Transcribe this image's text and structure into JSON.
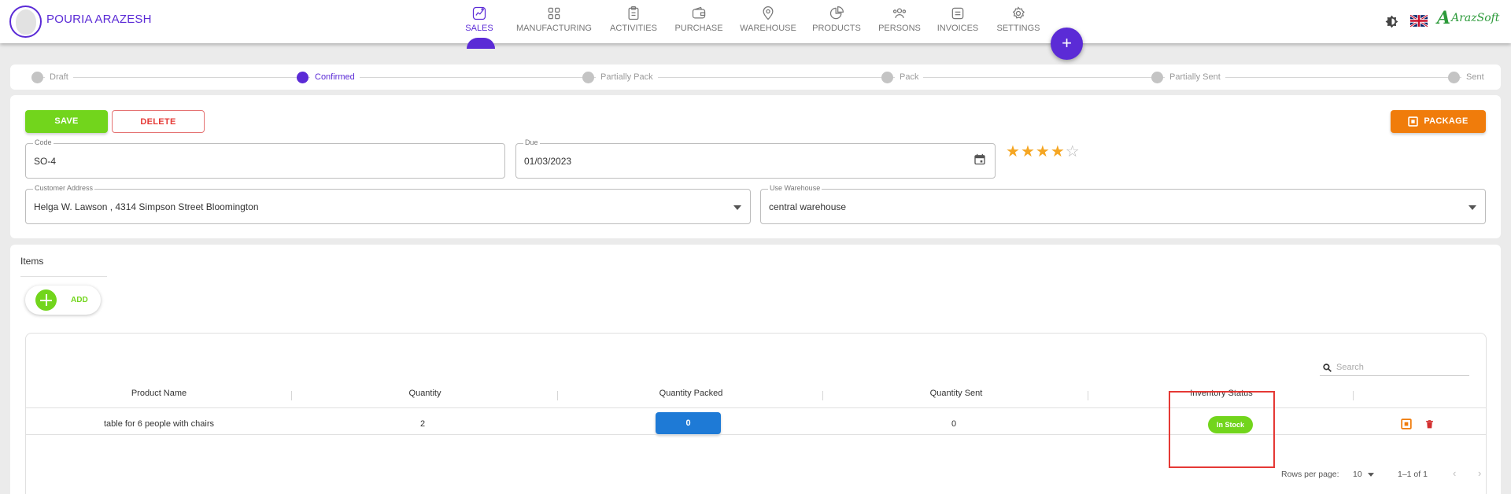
{
  "user": {
    "name": "POURIA ARAZESH"
  },
  "nav": [
    {
      "label": "SALES",
      "icon": "sales-chart-icon",
      "active": true
    },
    {
      "label": "MANUFACTURING",
      "icon": "manufacturing-grid-icon",
      "active": false
    },
    {
      "label": "ACTIVITIES",
      "icon": "activities-clipboard-icon",
      "active": false
    },
    {
      "label": "PURCHASE",
      "icon": "purchase-wallet-icon",
      "active": false
    },
    {
      "label": "WAREHOUSE",
      "icon": "warehouse-pin-icon",
      "active": false
    },
    {
      "label": "PRODUCTS",
      "icon": "products-pie-icon",
      "active": false
    },
    {
      "label": "PERSONS",
      "icon": "persons-icon",
      "active": false
    },
    {
      "label": "INVOICES",
      "icon": "invoices-icon",
      "active": false
    },
    {
      "label": "SETTINGS",
      "icon": "settings-gear-icon",
      "active": false
    }
  ],
  "fab": {
    "label": "+"
  },
  "brand": {
    "mark": "A",
    "text": "ArazSoft"
  },
  "stepper": {
    "steps": [
      "Draft",
      "Confirmed",
      "Partially Pack",
      "Pack",
      "Partially Sent",
      "Sent"
    ],
    "active_index": 1
  },
  "form": {
    "save_label": "SAVE",
    "delete_label": "DELETE",
    "package_label": "PACKAGE",
    "code": {
      "label": "Code",
      "value": "SO-4"
    },
    "due": {
      "label": "Due",
      "value": "01/03/2023"
    },
    "rating": {
      "value": 4,
      "max": 5
    },
    "customer_address": {
      "label": "Customer Address",
      "value": "Helga W. Lawson , 4314 Simpson Street Bloomington"
    },
    "warehouse": {
      "label": "Use Warehouse",
      "value": "central warehouse"
    }
  },
  "items": {
    "title": "Items",
    "add_label": "ADD",
    "search_placeholder": "Search",
    "columns": [
      "Product Name",
      "Quantity",
      "Quantity Packed",
      "Quantity Sent",
      "Inventory Status"
    ],
    "rows": [
      {
        "product": "table for 6 people with chairs",
        "quantity": "2",
        "quantity_packed": "0",
        "quantity_sent": "0",
        "status": "In Stock"
      }
    ],
    "rows_per_page_label": "Rows per page:",
    "rows_per_page": "10",
    "range": "1–1 of 1"
  },
  "colors": {
    "primary": "#5b2bd6",
    "save": "#72d51c",
    "delete": "#e53935",
    "package": "#f07c0b",
    "packed_button": "#1e7ad6",
    "star": "#f5a623",
    "highlight": "#e53935"
  }
}
